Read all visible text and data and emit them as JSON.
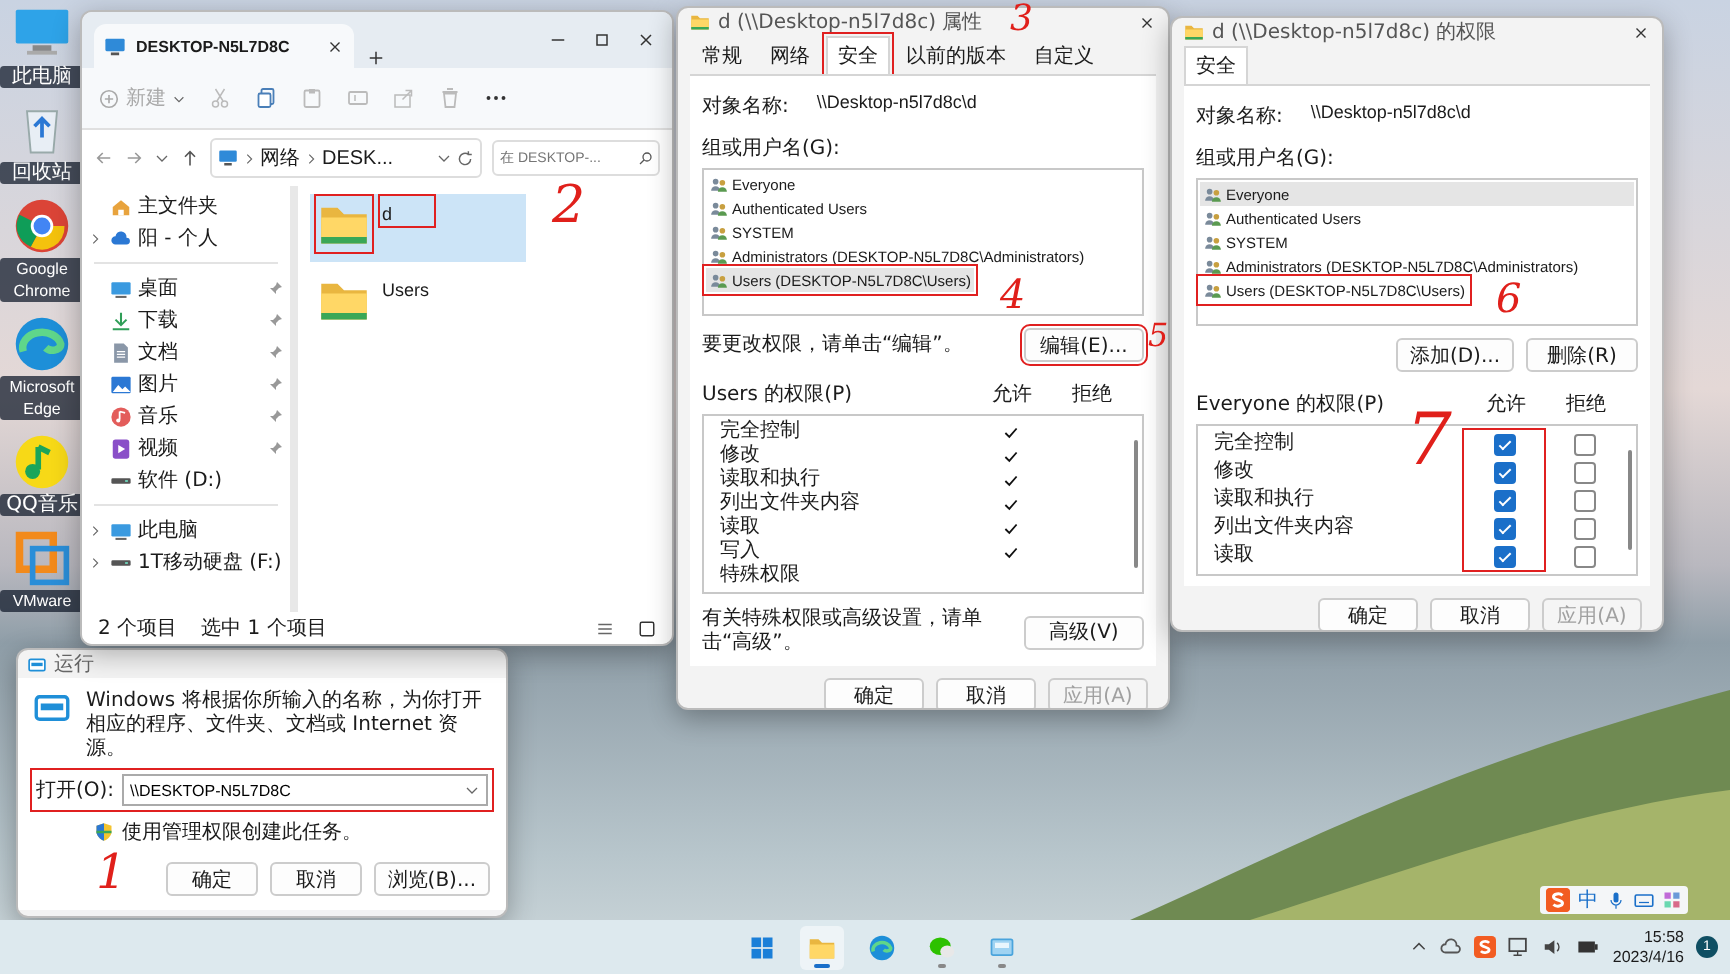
{
  "desktop_icons": [
    {
      "label": "此电脑",
      "kind": "monitor"
    },
    {
      "label": "回收站",
      "kind": "recycle"
    },
    {
      "label": "Google Chrome",
      "kind": "chrome"
    },
    {
      "label": "Microsoft Edge",
      "kind": "edge"
    },
    {
      "label": "QQ音乐",
      "kind": "music"
    },
    {
      "label": "VMware",
      "kind": "vmware"
    }
  ],
  "explorer": {
    "tab_title": "DESKTOP-N5L7D8C",
    "new_label": "新建",
    "breadcrumb": [
      "网络",
      "DESK..."
    ],
    "search": {
      "placeholder": "在 DESKTOP-..."
    },
    "nav_groups": [
      [
        {
          "label": "主文件夹",
          "kind": "home",
          "expandable": false,
          "pinned": false
        },
        {
          "label": "阳 - 个人",
          "kind": "cloud",
          "expandable": true,
          "pinned": false
        }
      ],
      [
        {
          "label": "桌面",
          "kind": "desktop",
          "expandable": false,
          "pinned": true
        },
        {
          "label": "下载",
          "kind": "download",
          "expandable": false,
          "pinned": true
        },
        {
          "label": "文档",
          "kind": "document",
          "expandable": false,
          "pinned": true
        },
        {
          "label": "图片",
          "kind": "picture",
          "expandable": false,
          "pinned": true
        },
        {
          "label": "音乐",
          "kind": "music",
          "expandable": false,
          "pinned": true
        },
        {
          "label": "视频",
          "kind": "video",
          "expandable": false,
          "pinned": true
        },
        {
          "label": "软件 (D:)",
          "kind": "drive",
          "expandable": false,
          "pinned": false
        }
      ],
      [
        {
          "label": "此电脑",
          "kind": "desktop",
          "expandable": true,
          "pinned": false
        },
        {
          "label": "1T移动硬盘 (F:)",
          "kind": "drive",
          "expandable": true,
          "pinned": false
        }
      ]
    ],
    "files": [
      {
        "name": "d",
        "selected": true,
        "highlighted": true
      },
      {
        "name": "Users",
        "selected": false,
        "highlighted": false
      }
    ],
    "status": {
      "count": "2 个项目",
      "selection": "选中 1 个项目"
    }
  },
  "run_dialog": {
    "title": "运行",
    "description": "Windows 将根据你所输入的名称，为你打开相应的程序、文件夹、文档或 Internet 资源。",
    "open_label": "打开(O):",
    "value": "\\\\DESKTOP-N5L7D8C",
    "highlighted": true,
    "admin_note": "使用管理权限创建此任务。",
    "buttons": [
      {
        "label": "确定"
      },
      {
        "label": "取消"
      },
      {
        "label": "浏览(B)..."
      }
    ]
  },
  "properties_dialog": {
    "title": "d (\\\\Desktop-n5l7d8c) 属性",
    "tabs": [
      {
        "label": "常规",
        "selected": false,
        "highlighted": false
      },
      {
        "label": "网络",
        "selected": false,
        "highlighted": false
      },
      {
        "label": "安全",
        "selected": true,
        "highlighted": true
      },
      {
        "label": "以前的版本",
        "selected": false,
        "highlighted": false
      },
      {
        "label": "自定义",
        "selected": false,
        "highlighted": false
      }
    ],
    "object_label": "对象名称:",
    "object_value": "\\\\Desktop-n5l7d8c\\d",
    "group_label": "组或用户名(G):",
    "principals": [
      {
        "name": "Everyone",
        "selected": false,
        "highlighted": false
      },
      {
        "name": "Authenticated Users",
        "selected": false,
        "highlighted": false
      },
      {
        "name": "SYSTEM",
        "selected": false,
        "highlighted": false
      },
      {
        "name": "Administrators (DESKTOP-N5L7D8C\\Administrators)",
        "selected": false,
        "highlighted": false
      },
      {
        "name": "Users (DESKTOP-N5L7D8C\\Users)",
        "selected": true,
        "highlighted": true
      }
    ],
    "edit_note": "要更改权限，请单击“编辑”。",
    "edit_button": {
      "label": "编辑(E)...",
      "highlighted": true
    },
    "permissions_label": "Users 的权限(P)",
    "allow_label": "允许",
    "deny_label": "拒绝",
    "permissions": [
      {
        "name": "完全控制",
        "allow": true,
        "deny": false
      },
      {
        "name": "修改",
        "allow": true,
        "deny": false
      },
      {
        "name": "读取和执行",
        "allow": true,
        "deny": false
      },
      {
        "name": "列出文件夹内容",
        "allow": true,
        "deny": false
      },
      {
        "name": "读取",
        "allow": true,
        "deny": false
      },
      {
        "name": "写入",
        "allow": true,
        "deny": false
      },
      {
        "name": "特殊权限",
        "allow": false,
        "deny": false
      }
    ],
    "advanced_note": "有关特殊权限或高级设置，请单击“高级”。",
    "advanced_button": "高级(V)",
    "buttons": [
      {
        "label": "确定",
        "disabled": false
      },
      {
        "label": "取消",
        "disabled": false
      },
      {
        "label": "应用(A)",
        "disabled": true
      }
    ]
  },
  "permissions_dialog": {
    "title": "d (\\\\Desktop-n5l7d8c) 的权限",
    "tabs": [
      {
        "label": "安全",
        "selected": true
      }
    ],
    "object_label": "对象名称:",
    "object_value": "\\\\Desktop-n5l7d8c\\d",
    "group_label": "组或用户名(G):",
    "principals": [
      {
        "name": "Everyone",
        "selected": true,
        "highlighted": false
      },
      {
        "name": "Authenticated Users",
        "selected": false,
        "highlighted": false
      },
      {
        "name": "SYSTEM",
        "selected": false,
        "highlighted": false
      },
      {
        "name": "Administrators (DESKTOP-N5L7D8C\\Administrators)",
        "selected": false,
        "highlighted": false
      },
      {
        "name": "Users (DESKTOP-N5L7D8C\\Users)",
        "selected": false,
        "highlighted": true
      }
    ],
    "action_buttons": [
      "添加(D)...",
      "删除(R)"
    ],
    "permissions_label": "Everyone 的权限(P)",
    "allow_label": "允许",
    "deny_label": "拒绝",
    "allow_highlighted": true,
    "permissions": [
      {
        "name": "完全控制",
        "allow": true,
        "deny": false
      },
      {
        "name": "修改",
        "allow": true,
        "deny": false
      },
      {
        "name": "读取和执行",
        "allow": true,
        "deny": false
      },
      {
        "name": "列出文件夹内容",
        "allow": true,
        "deny": false
      },
      {
        "name": "读取",
        "allow": true,
        "deny": false
      }
    ],
    "buttons": [
      {
        "label": "确定",
        "disabled": false
      },
      {
        "label": "取消",
        "disabled": false
      },
      {
        "label": "应用(A)",
        "disabled": true
      }
    ]
  },
  "ime_toolbar": {
    "mode": "中"
  },
  "taskbar": {
    "apps": [
      {
        "kind": "start",
        "running": false,
        "selected": false
      },
      {
        "kind": "explorer",
        "running": true,
        "selected": true
      },
      {
        "kind": "edge",
        "running": false,
        "selected": false
      },
      {
        "kind": "wechat",
        "running": true,
        "selected": false
      },
      {
        "kind": "remote",
        "running": true,
        "selected": false
      }
    ],
    "time": "15:58",
    "date": "2023/4/16",
    "notifications": "1"
  },
  "annotations": [
    "1",
    "2",
    "3",
    "4",
    "5",
    "6",
    "7"
  ]
}
